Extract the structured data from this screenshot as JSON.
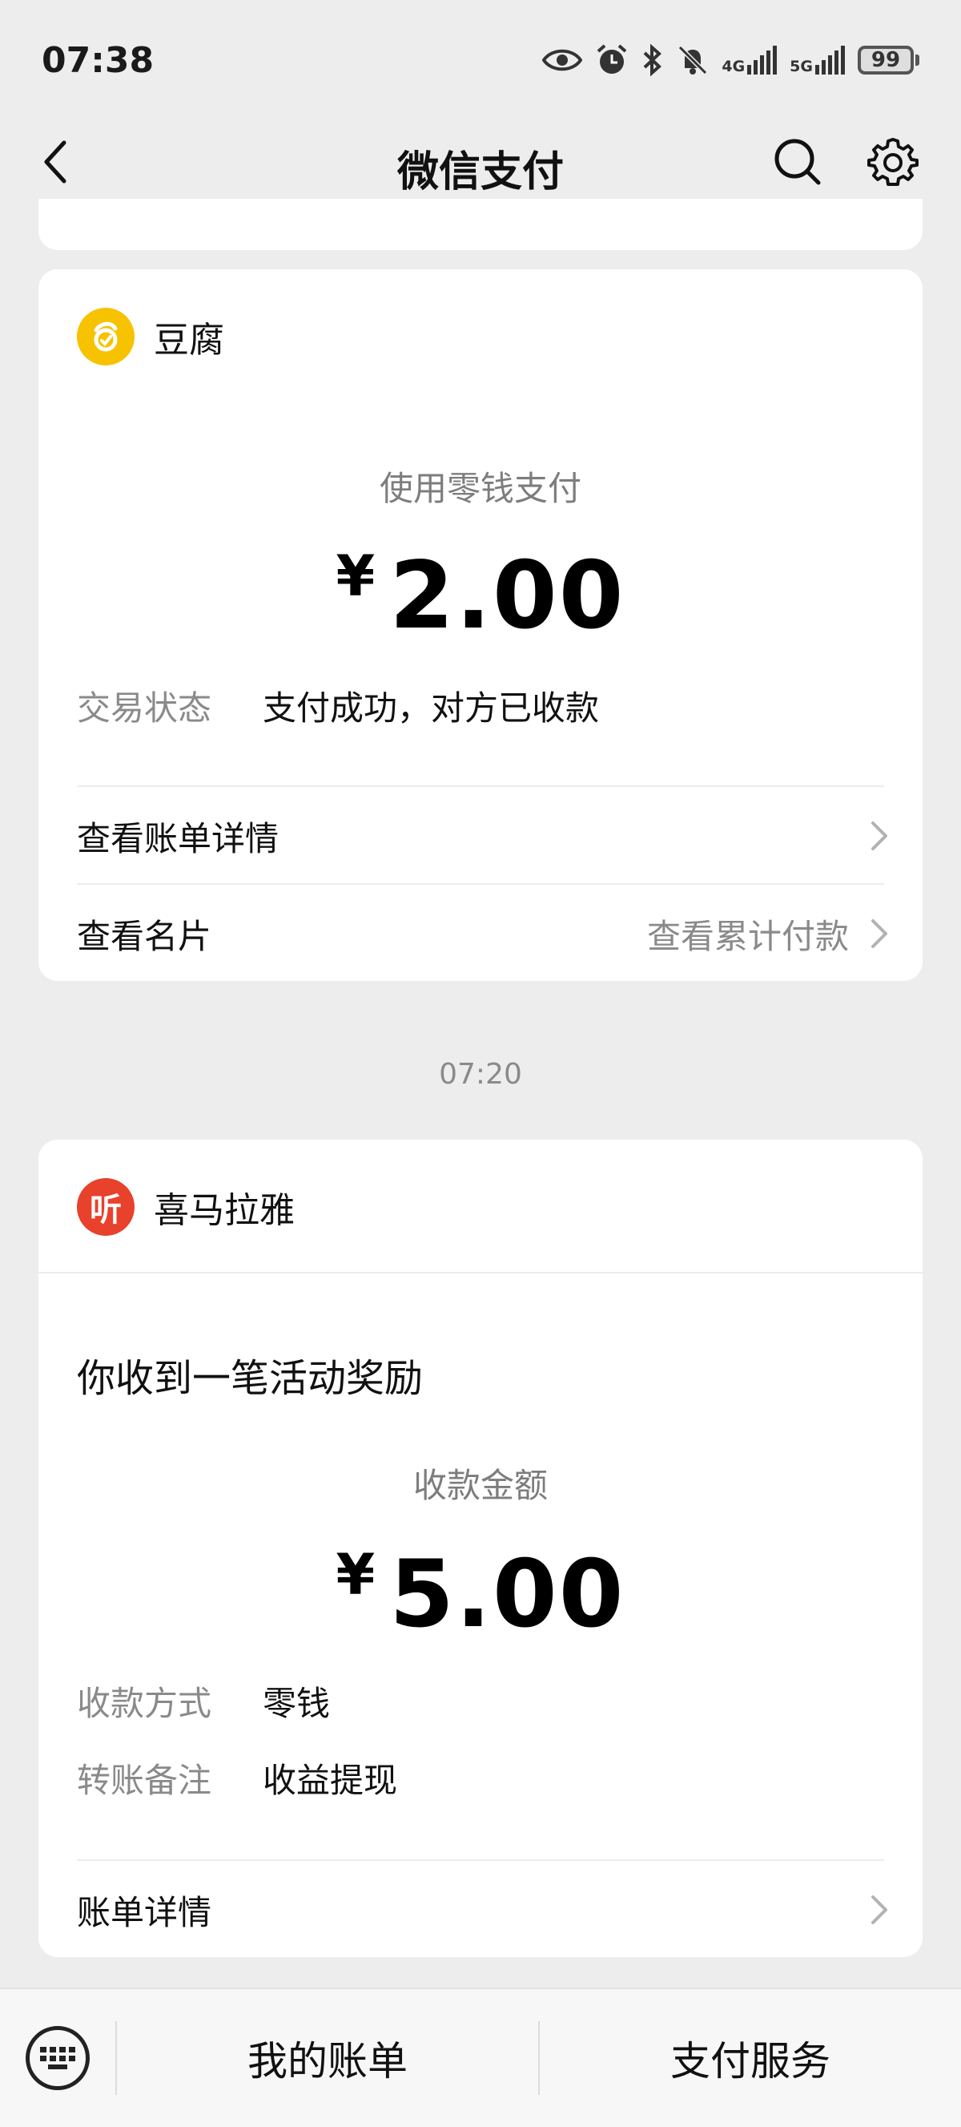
{
  "status_bar": {
    "time": "07:38",
    "network_4g": "4G",
    "network_5g": "5G",
    "battery": "99",
    "icons": [
      "eye-icon",
      "alarm-icon",
      "bluetooth-icon",
      "mute-icon",
      "signal-4g-icon",
      "signal-5g-icon",
      "battery-icon"
    ]
  },
  "nav": {
    "title": "微信支付",
    "back_icon": "chevron-left-icon",
    "search_icon": "search-icon",
    "settings_icon": "gear-icon"
  },
  "card1": {
    "merchant_name": "豆腐",
    "merchant_logo_color": "#f7c200",
    "subtitle": "使用零钱支付",
    "currency": "¥",
    "amount": "2.00",
    "status_label": "交易状态",
    "status_value": "支付成功，对方已收款",
    "bill_detail_label": "查看账单详情",
    "card_label": "查看名片",
    "cumulative_label": "查看累计付款"
  },
  "timestamp": "07:20",
  "card2": {
    "merchant_name": "喜马拉雅",
    "merchant_logo_color": "#e8412c",
    "merchant_logo_text": "听",
    "notice": "你收到一笔活动奖励",
    "subtitle": "收款金额",
    "currency": "¥",
    "amount": "5.00",
    "method_label": "收款方式",
    "method_value": "零钱",
    "note_label": "转账备注",
    "note_value": "收益提现",
    "bill_detail_label": "账单详情"
  },
  "bottom_bar": {
    "keyboard_icon": "keyboard-icon",
    "tab1": "我的账单",
    "tab2": "支付服务"
  }
}
